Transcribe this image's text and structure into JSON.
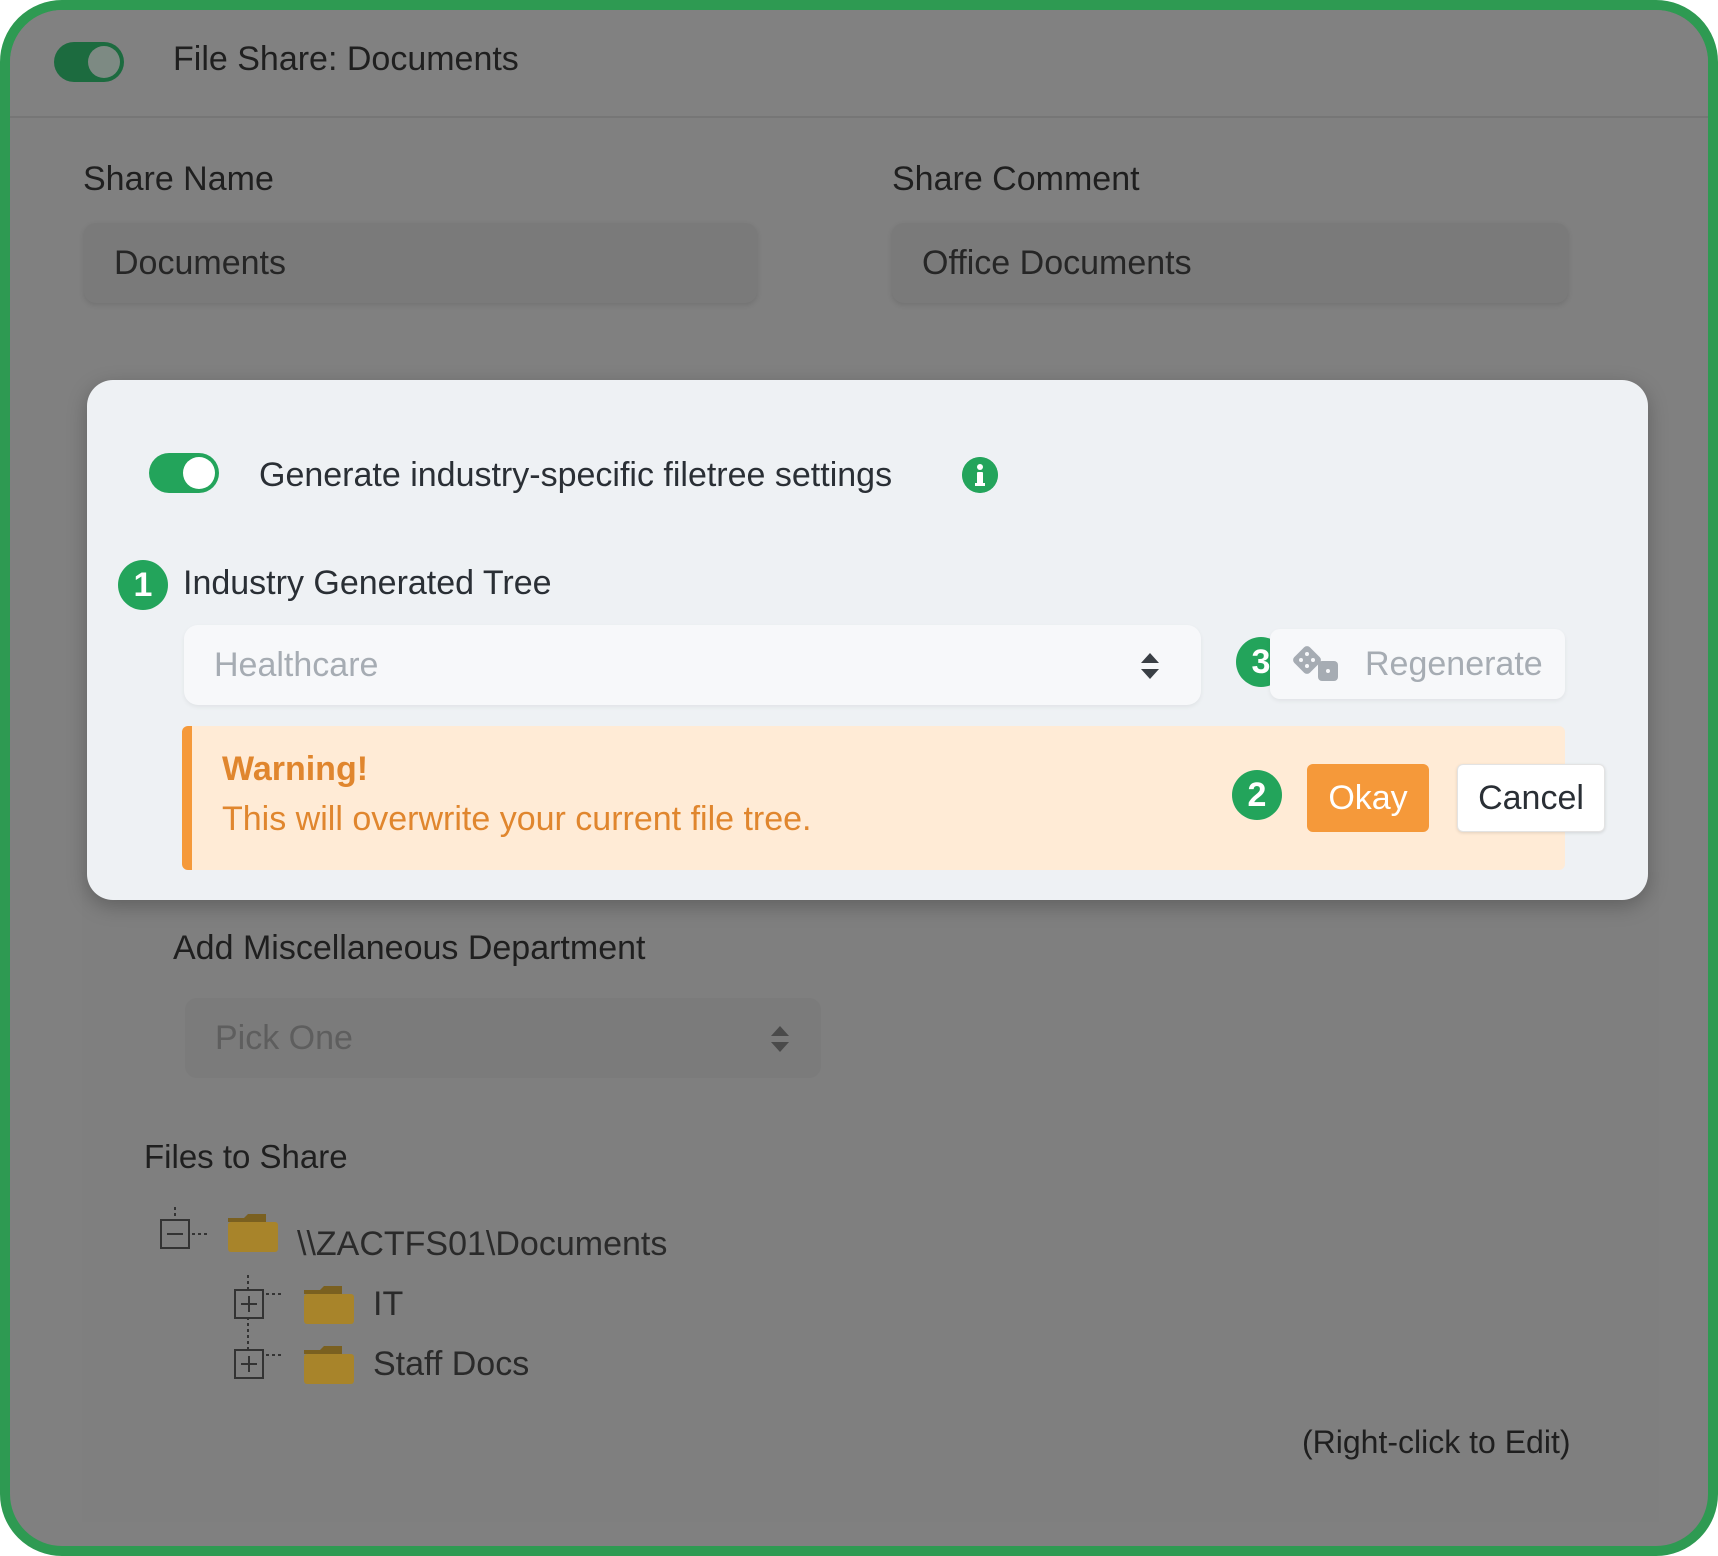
{
  "header": {
    "toggle_on": true,
    "title": "File Share: Documents"
  },
  "share_name": {
    "label": "Share Name",
    "value": "Documents"
  },
  "share_comment": {
    "label": "Share Comment",
    "value": "Office Documents"
  },
  "modal": {
    "toggle_on": true,
    "generate_label": "Generate industry-specific filetree settings",
    "info_icon": "info-icon",
    "step1": "1",
    "tree_label": "Industry Generated Tree",
    "industry_select": "Healthcare",
    "step3": "3",
    "regenerate_icon": "dice-icon",
    "regenerate_label": "Regenerate",
    "warning": {
      "title": "Warning!",
      "text": "This will overwrite your current file tree.",
      "step2": "2",
      "okay_label": "Okay",
      "cancel_label": "Cancel"
    }
  },
  "misc_department": {
    "label": "Add Miscellaneous Department",
    "select_value": "Pick One"
  },
  "files": {
    "label": "Files to Share",
    "tree": [
      {
        "name": "\\\\ZACTFS01\\Documents",
        "expander": "collapse",
        "icon": "folder-icon"
      },
      {
        "name": "IT",
        "expander": "expand",
        "icon": "folder-icon"
      },
      {
        "name": "Staff Docs",
        "expander": "expand",
        "icon": "folder-icon"
      }
    ],
    "hint": "(Right-click to Edit)"
  },
  "colors": {
    "accent_green": "#23a45b",
    "frame_green": "#2e9a52",
    "warning_orange": "#f5993a",
    "warning_bg": "#ffebd6",
    "overlay_gray": "#808080"
  }
}
